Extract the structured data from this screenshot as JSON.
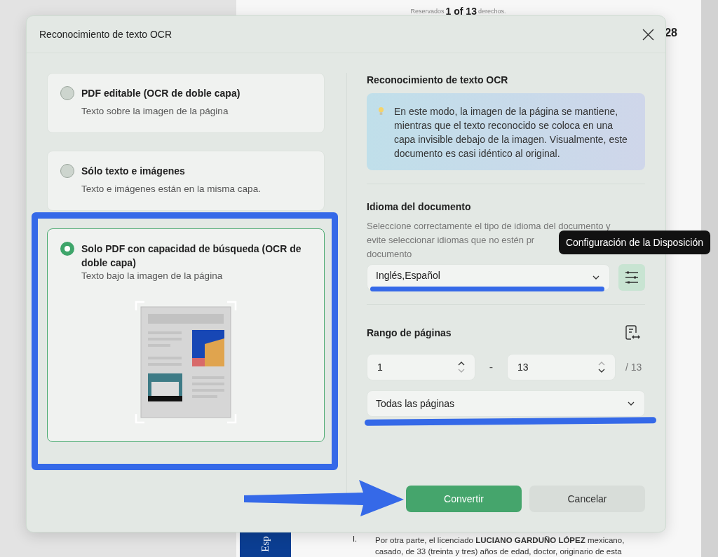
{
  "background_document": {
    "header_left": "Reservados",
    "page_indicator": "1 of 13",
    "header_right": "derechos.",
    "page_number": "28",
    "side_tab": "Esp",
    "list_marker": "I.",
    "paragraph_lines": [
      "Por otra parte, el licenciado **LUCIANO GARDUÑO LÓPEZ** mexicano,",
      "casado, de 33 (treinta y tres) años de edad, doctor, originario de esta"
    ]
  },
  "dialog": {
    "title": "Reconocimiento de texto OCR",
    "options": [
      {
        "title": "PDF editable (OCR de doble capa)",
        "subtitle": "Texto sobre la imagen de la página",
        "selected": false
      },
      {
        "title": "Sólo texto e imágenes",
        "subtitle": "Texto e imágenes están en la misma capa.",
        "selected": false
      },
      {
        "title": "Solo PDF con capacidad de búsqueda (OCR de doble capa)",
        "subtitle": "Texto bajo la imagen de la página",
        "selected": true
      }
    ],
    "info_title": "Reconocimiento de texto OCR",
    "info_text": "En este modo, la imagen de la página se mantiene, mientras que el texto reconocido se coloca en una capa invisible debajo de la imagen. Visualmente, este documento es casi idéntico al original.",
    "language": {
      "title": "Idioma del documento",
      "description_lines": [
        "Seleccione correctamente el tipo de idioma del documento y",
        "evite seleccionar idiomas que no estén pr",
        "documento"
      ],
      "value": "Inglés,Español",
      "tooltip": "Configuración de la Disposición"
    },
    "page_range": {
      "title": "Rango de páginas",
      "from": "1",
      "separator": "-",
      "to": "13",
      "total": "/ 13",
      "mode": "Todas las páginas"
    },
    "buttons": [
      {
        "label": "Convertir",
        "kind": "primary"
      },
      {
        "label": "Cancelar",
        "kind": "secondary"
      }
    ]
  }
}
